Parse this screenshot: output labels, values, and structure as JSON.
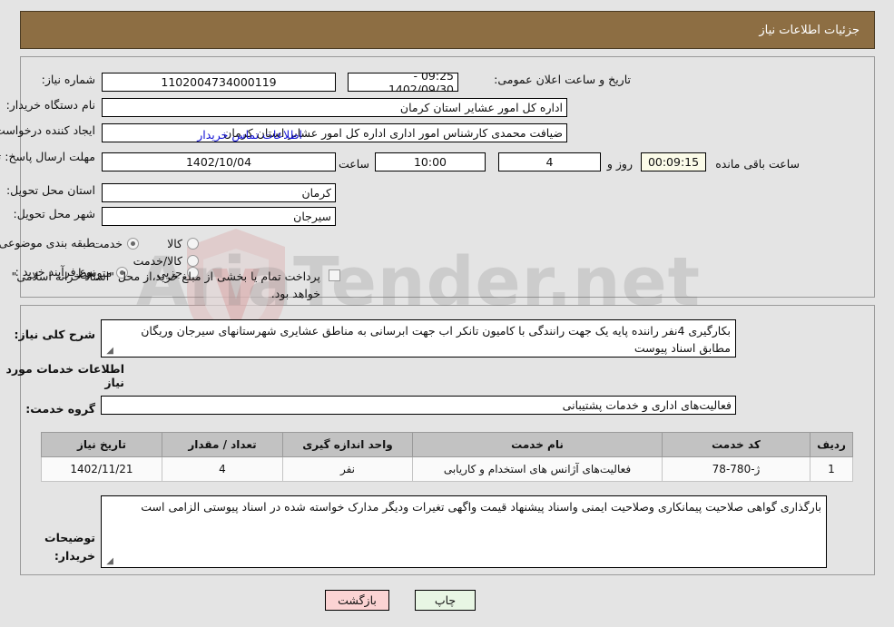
{
  "header": {
    "title": "جزئیات اطلاعات نیاز"
  },
  "form": {
    "need_number_label": "شماره نیاز:",
    "need_number_value": "1102004734000119",
    "public_announce_label": "تاریخ و ساعت اعلان عمومی:",
    "public_announce_value": "09:25 - 1402/09/30",
    "buyer_org_label": "نام دستگاه خریدار:",
    "buyer_org_value": "اداره کل امور عشایر استان کرمان",
    "creator_label": "ایجاد کننده درخواست:",
    "creator_value": "ضیافت محمدی کارشناس امور اداری اداره کل امور عشایر استان کرمان",
    "contact_link": "اطلاعات تماس خریدار",
    "deadline_label": "مهلت ارسال پاسخ: تا تاریخ:",
    "deadline_date": "1402/10/04",
    "hour_label": "ساعت",
    "hour_value": "10:00",
    "days_value": "4",
    "days_and_label": "روز و",
    "timer_value": "00:09:15",
    "remaining_label": "ساعت باقی مانده",
    "province_label": "استان محل تحویل:",
    "province_value": "کرمان",
    "city_label": "شهر محل تحویل:",
    "city_value": "سیرجان",
    "category_label": "طبقه بندی موضوعی:",
    "category_options": [
      {
        "label": "کالا",
        "selected": false
      },
      {
        "label": "خدمت",
        "selected": true
      },
      {
        "label": "کالا/خدمت",
        "selected": false
      }
    ],
    "process_label": "نوع فرآیند خرید :",
    "process_options": [
      {
        "label": "جزیی",
        "selected": false
      },
      {
        "label": "متوسط",
        "selected": true
      }
    ],
    "treasury_checkbox_checked": false,
    "treasury_note": "پرداخت تمام یا بخشی از مبلغ خرید،از محل \"اسناد خزانه اسلامی\" خواهد بود."
  },
  "description": {
    "label": "شرح کلی نیاز:",
    "value": "بکارگیری 4نفر راننده پایه یک جهت رانندگی با کامیون تانکر اب جهت ابرسانی به مناطق عشایری شهرستانهای سیرجان وریگان مطابق اسناد پیوست"
  },
  "services_section": {
    "title": "اطلاعات خدمات مورد نیاز",
    "group_label": "گروه خدمت:",
    "group_value": "فعالیت‌های اداری و خدمات پشتیبانی"
  },
  "table": {
    "columns": [
      "ردیف",
      "کد خدمت",
      "نام خدمت",
      "واحد اندازه گیری",
      "تعداد / مقدار",
      "تاریخ نیاز"
    ],
    "rows": [
      {
        "row_no": "1",
        "service_code": "ژ-780-78",
        "service_name": "فعالیت‌های آژانس های استخدام و کاریابی",
        "unit": "نفر",
        "quantity": "4",
        "need_date": "1402/11/21"
      }
    ]
  },
  "buyer_notes": {
    "label": "توضیحات خریدار:",
    "value": "بارگذاری گواهی صلاحیت پیمانکاری  وصلاحیت ایمنی واسناد پیشنهاد قیمت واگهی تغیرات ودیگر مدارک خواسته شده در اسناد پیوستی الزامی است"
  },
  "footer": {
    "back_label": "بازگشت",
    "print_label": "چاپ"
  },
  "watermark": {
    "text": "AriaTender.net",
    "text2": "AriaTender.net"
  },
  "colors": {
    "header_brown": "#8d6e43",
    "link_blue": "#1414d6",
    "timer_bg": "#fbfbe8",
    "back_btn": "#fbd3d3",
    "print_btn": "#e8f6e4",
    "table_header": "#c2c2c2",
    "page_bg": "#e4e4e4"
  }
}
